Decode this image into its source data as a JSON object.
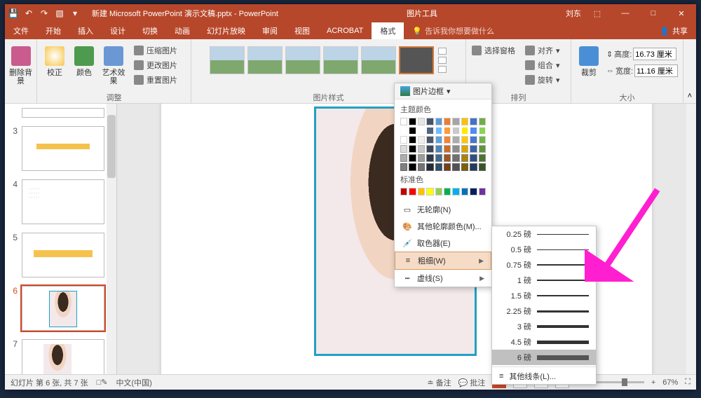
{
  "title_left": "新建 Microsoft PowerPoint 演示文稿.pptx - PowerPoint",
  "title_tools": "图片工具",
  "user": "刘东",
  "tabs": {
    "file": "文件",
    "home": "开始",
    "insert": "插入",
    "design": "设计",
    "trans": "切换",
    "anim": "动画",
    "show": "幻灯片放映",
    "review": "审阅",
    "view": "视图",
    "acrobat": "ACROBAT",
    "format": "格式",
    "tell": "告诉我你想要做什么"
  },
  "share": "共享",
  "ribbon": {
    "removebg": "删除背景",
    "correct": "校正",
    "color": "颜色",
    "effects": "艺术效果",
    "compress": "压缩图片",
    "change": "更改图片",
    "reset": "重置图片",
    "adjust": "调整",
    "styles": "图片样式",
    "arrange": "排列",
    "size": "大小",
    "border": "图片边框",
    "select": "选择窗格",
    "align": "对齐",
    "group": "组合",
    "rotate": "旋转",
    "crop": "裁剪",
    "height_lbl": "高度:",
    "height_val": "16.73 厘米",
    "width_lbl": "宽度:",
    "width_val": "11.16 厘米"
  },
  "border_menu": {
    "theme_colors": "主题颜色",
    "standard_colors": "标准色",
    "no_outline": "无轮廓(N)",
    "more_outline": "其他轮廓颜色(M)...",
    "eyedropper": "取色器(E)",
    "weight": "粗细(W)",
    "dashes": "虚线(S)"
  },
  "weight_menu": {
    "items": [
      "0.25 磅",
      "0.5 磅",
      "0.75 磅",
      "1 磅",
      "1.5 磅",
      "2.25 磅",
      "3 磅",
      "4.5 磅",
      "6 磅"
    ],
    "more": "其他线条(L)..."
  },
  "slides": {
    "nums": [
      "3",
      "4",
      "5",
      "6",
      "7"
    ]
  },
  "status": {
    "slide": "幻灯片 第 6 张, 共 7 张",
    "lang": "中文(中国)",
    "notes": "备注",
    "comments": "批注",
    "zoom": "67%"
  }
}
